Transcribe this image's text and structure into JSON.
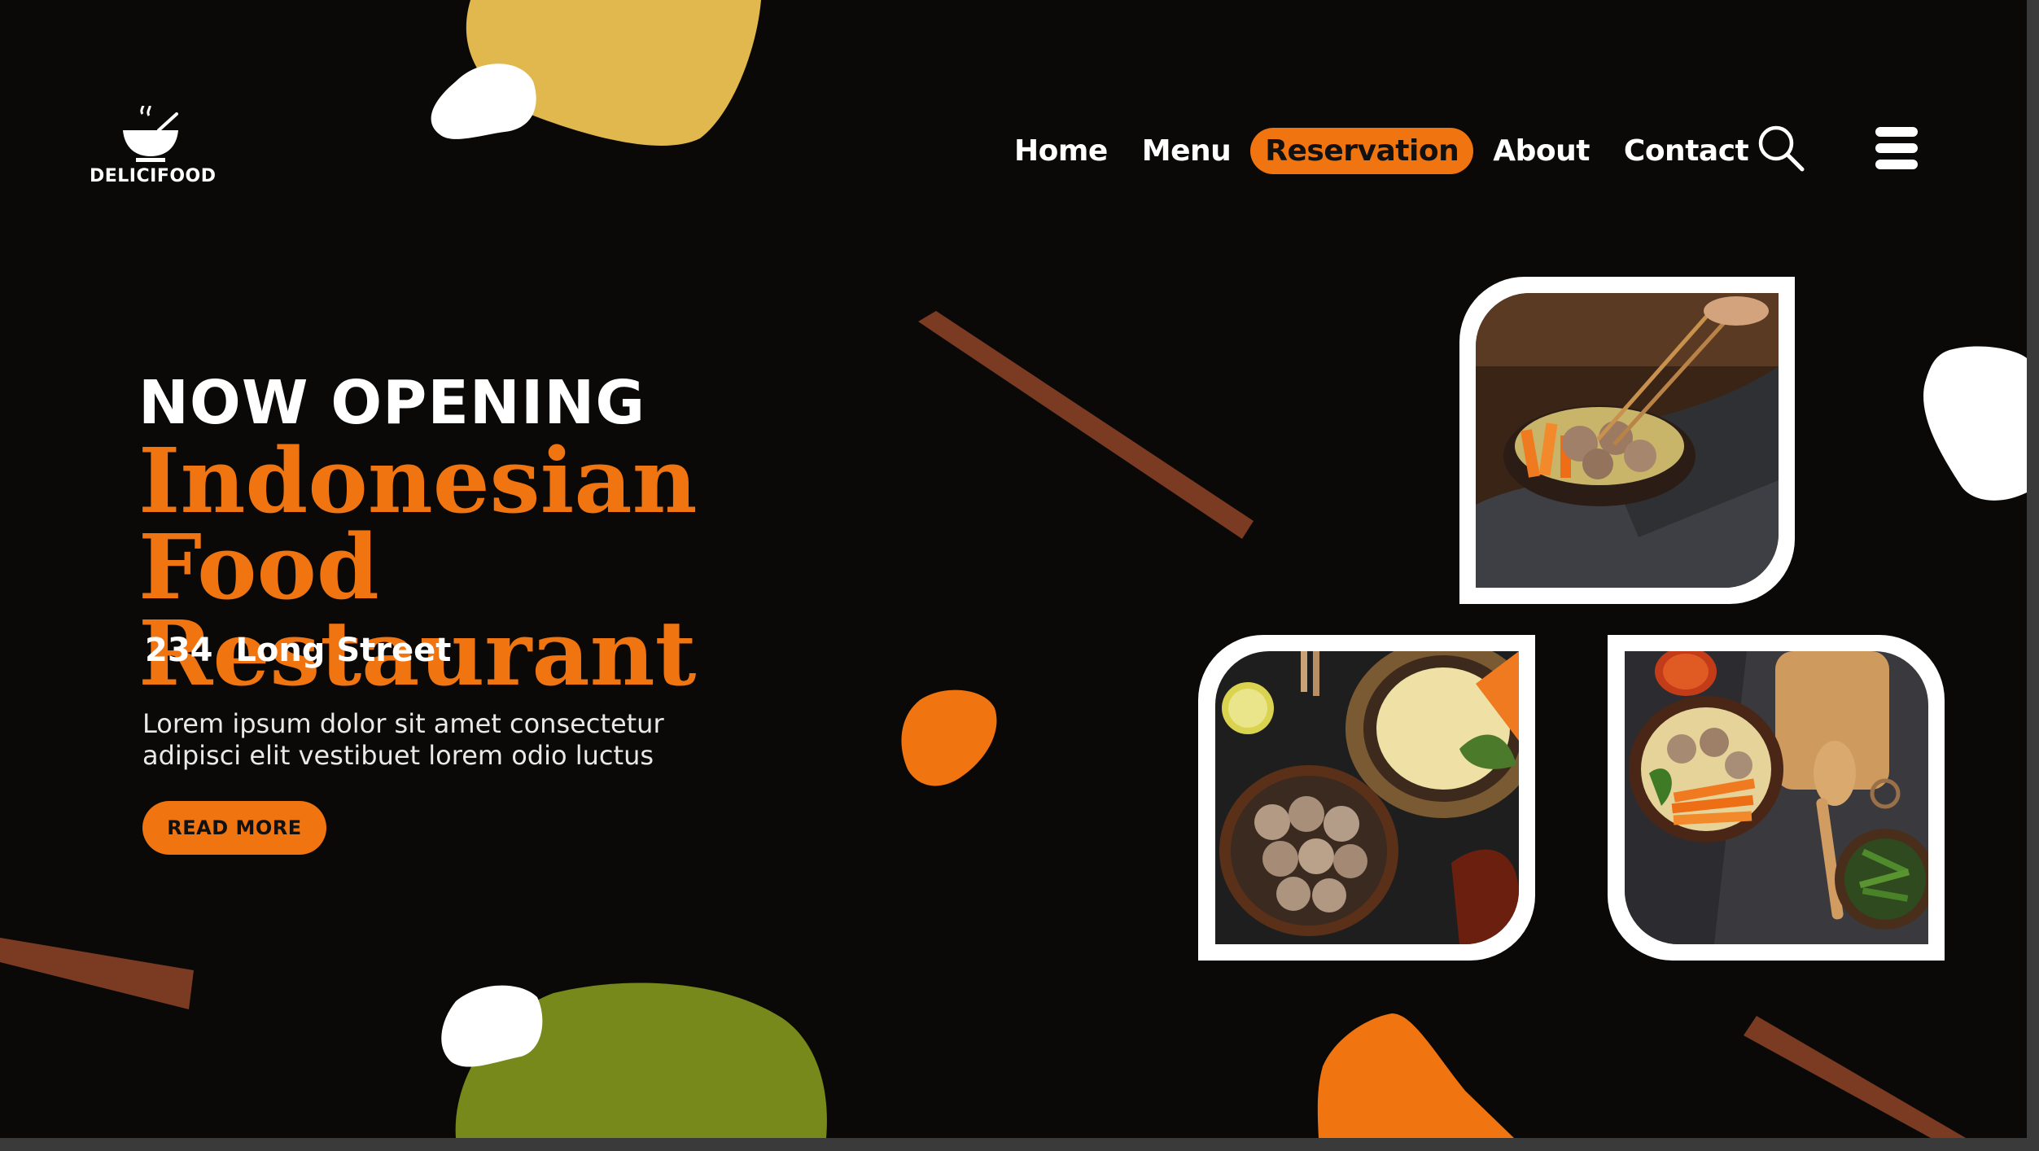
{
  "logo": {
    "text": "DELICIFOOD"
  },
  "nav": {
    "items": [
      {
        "label": "Home"
      },
      {
        "label": "Menu"
      },
      {
        "label": "Reservation"
      },
      {
        "label": "About"
      },
      {
        "label": "Contact"
      }
    ],
    "active_index": 2
  },
  "icons": {
    "search": "search-icon",
    "menu": "hamburger-menu-icon",
    "logo": "bowl-icon"
  },
  "hero": {
    "kicker": "NOW OPENING",
    "title_line1": "Indonesian Food",
    "title_line2": "Restaurant",
    "address": "234  Long Street",
    "description_line1": "Lorem ipsum dolor sit amet consectetur",
    "description_line2": "adipisci elit vestibuet lorem odio luctus",
    "button_label": "READ MORE"
  },
  "photos": [
    {
      "name": "meatball-soup-chopsticks-photo"
    },
    {
      "name": "meatballs-noodles-photo"
    },
    {
      "name": "meatball-bowl-spoon-photo"
    }
  ],
  "colors": {
    "background": "#0b0908",
    "accent": "#f0740f",
    "mustard": "#e0b84e",
    "olive": "#76891a",
    "brown": "#7a3b22",
    "white": "#ffffff"
  }
}
